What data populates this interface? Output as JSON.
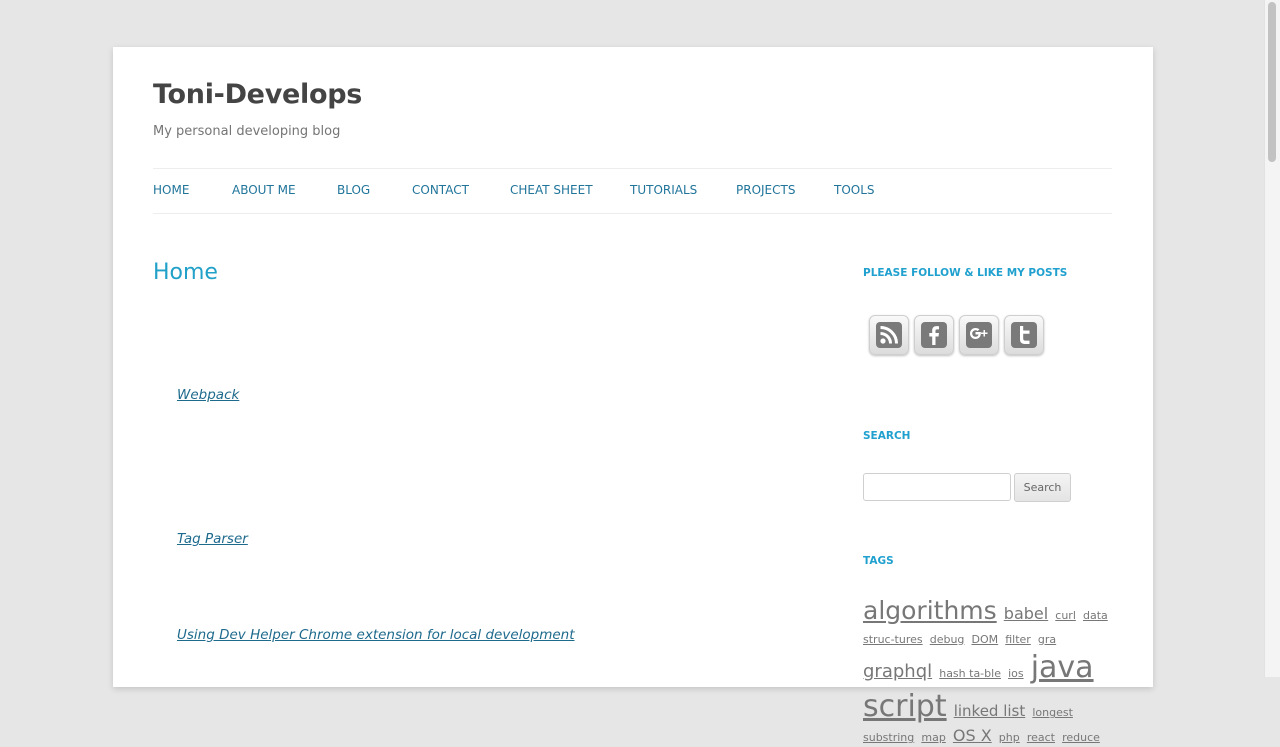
{
  "site": {
    "title": "Toni-Develops",
    "description": "My personal developing blog"
  },
  "nav": {
    "items": [
      "HOME",
      "ABOUT ME",
      "BLOG",
      "CONTACT",
      "CHEAT SHEET",
      "TUTORIALS",
      "PROJECTS",
      "TOOLS"
    ]
  },
  "main": {
    "heading": "Home",
    "posts": [
      "Webpack",
      "Tag Parser",
      "Using Dev Helper Chrome extension for local development"
    ]
  },
  "sidebar": {
    "follow_title": "PLEASE FOLLOW & LIKE MY POSTS",
    "social_icons": [
      "rss-icon",
      "facebook-icon",
      "google-plus-icon",
      "twitter-icon"
    ],
    "search_title": "SEARCH",
    "search_value": "",
    "search_button": "Search",
    "tags_title": "TAGS",
    "tags": [
      {
        "label": "algorithms",
        "size": 25
      },
      {
        "label": "babel",
        "size": 16
      },
      {
        "label": "curl",
        "size": 11
      },
      {
        "label": "data struc-tures",
        "size": 11
      },
      {
        "label": "debug",
        "size": 11
      },
      {
        "label": "DOM",
        "size": 11
      },
      {
        "label": "filter",
        "size": 11
      },
      {
        "label": "gra",
        "size": 11
      },
      {
        "label": "graphql",
        "size": 18
      },
      {
        "label": "hash ta-ble",
        "size": 11
      },
      {
        "label": "ios",
        "size": 11
      },
      {
        "label": "java script",
        "size": 30
      },
      {
        "label": "linked list",
        "size": 15
      },
      {
        "label": "longest substring",
        "size": 11
      },
      {
        "label": "map",
        "size": 11
      },
      {
        "label": "OS X",
        "size": 16
      },
      {
        "label": "php",
        "size": 11
      },
      {
        "label": "react",
        "size": 11
      },
      {
        "label": "reduce",
        "size": 11
      }
    ]
  },
  "colors": {
    "accent": "#21759b",
    "widget_title": "#1fa0ce",
    "page_background": "#e6e6e6"
  }
}
